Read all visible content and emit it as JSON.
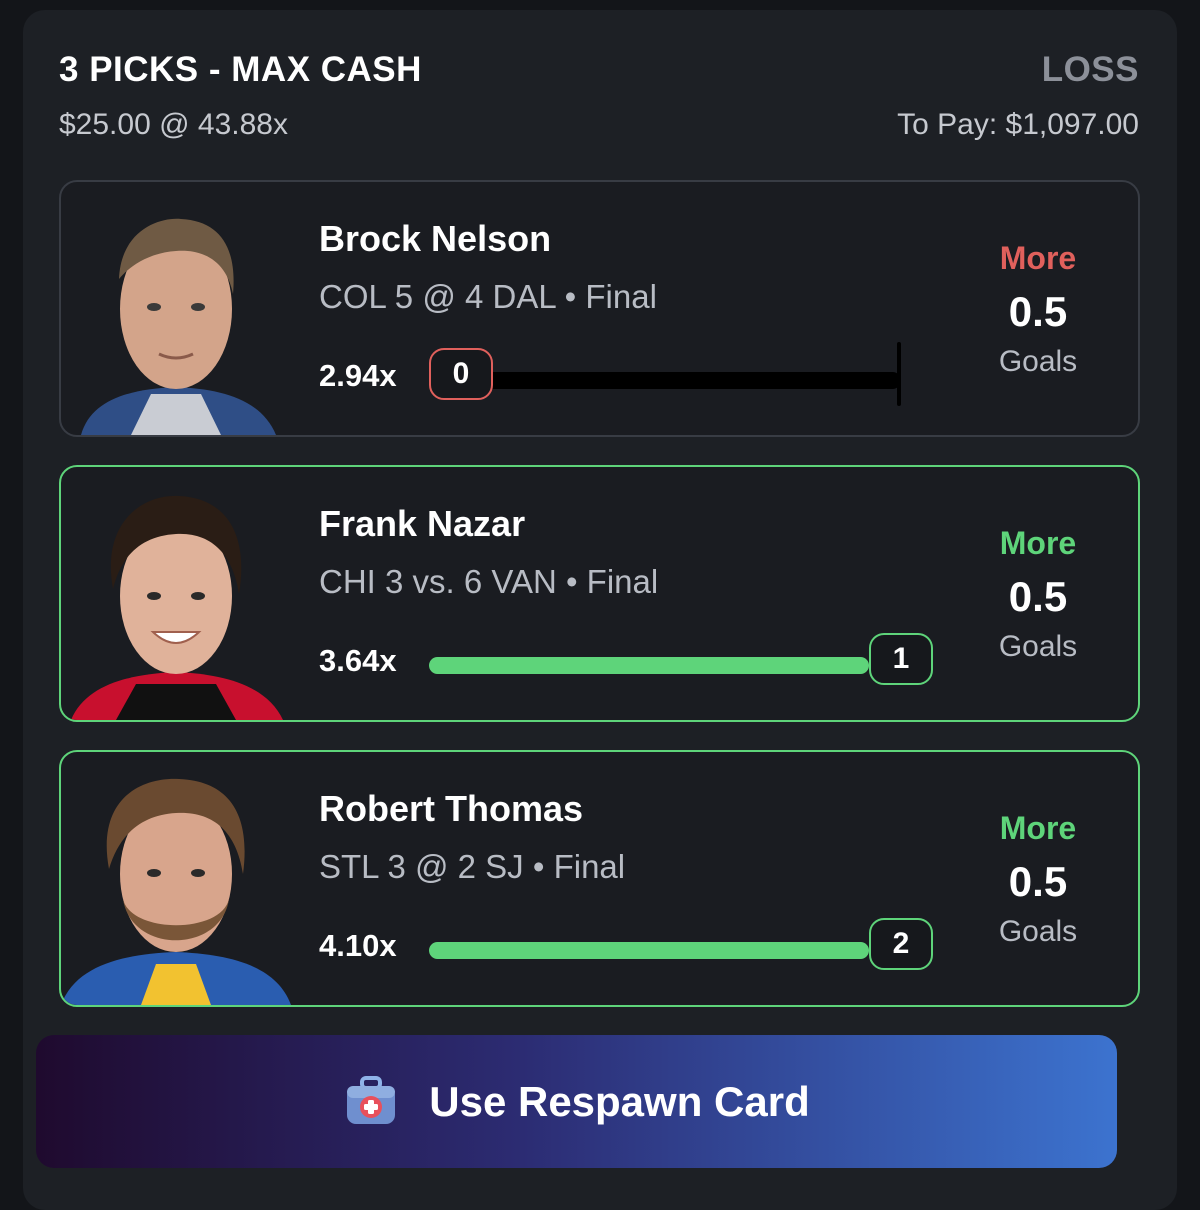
{
  "header": {
    "title": "3 PICKS - MAX CASH",
    "result": "LOSS",
    "wager": "$25.00 @ 43.88x",
    "payout": "To Pay: $1,097.00"
  },
  "picks": [
    {
      "player": "Brock Nelson",
      "game": "COL 5 @ 4 DAL • Final",
      "multiplier": "2.94x",
      "score": "0",
      "progress_fraction": 0,
      "direction": "More",
      "line": "0.5",
      "stat": "Goals",
      "status": "miss"
    },
    {
      "player": "Frank Nazar",
      "game": "CHI 3 vs. 6 VAN • Final",
      "multiplier": "3.64x",
      "score": "1",
      "progress_fraction": 1,
      "direction": "More",
      "line": "0.5",
      "stat": "Goals",
      "status": "hit"
    },
    {
      "player": "Robert Thomas",
      "game": "STL 3 @ 2 SJ • Final",
      "multiplier": "4.10x",
      "score": "2",
      "progress_fraction": 1,
      "direction": "More",
      "line": "0.5",
      "stat": "Goals",
      "status": "hit"
    }
  ],
  "respawn": {
    "label": "Use Respawn Card",
    "icon": "first-aid-kit-icon"
  },
  "colors": {
    "win": "#5ed47a",
    "loss": "#e0605c",
    "loss_label": "#8c9099"
  }
}
